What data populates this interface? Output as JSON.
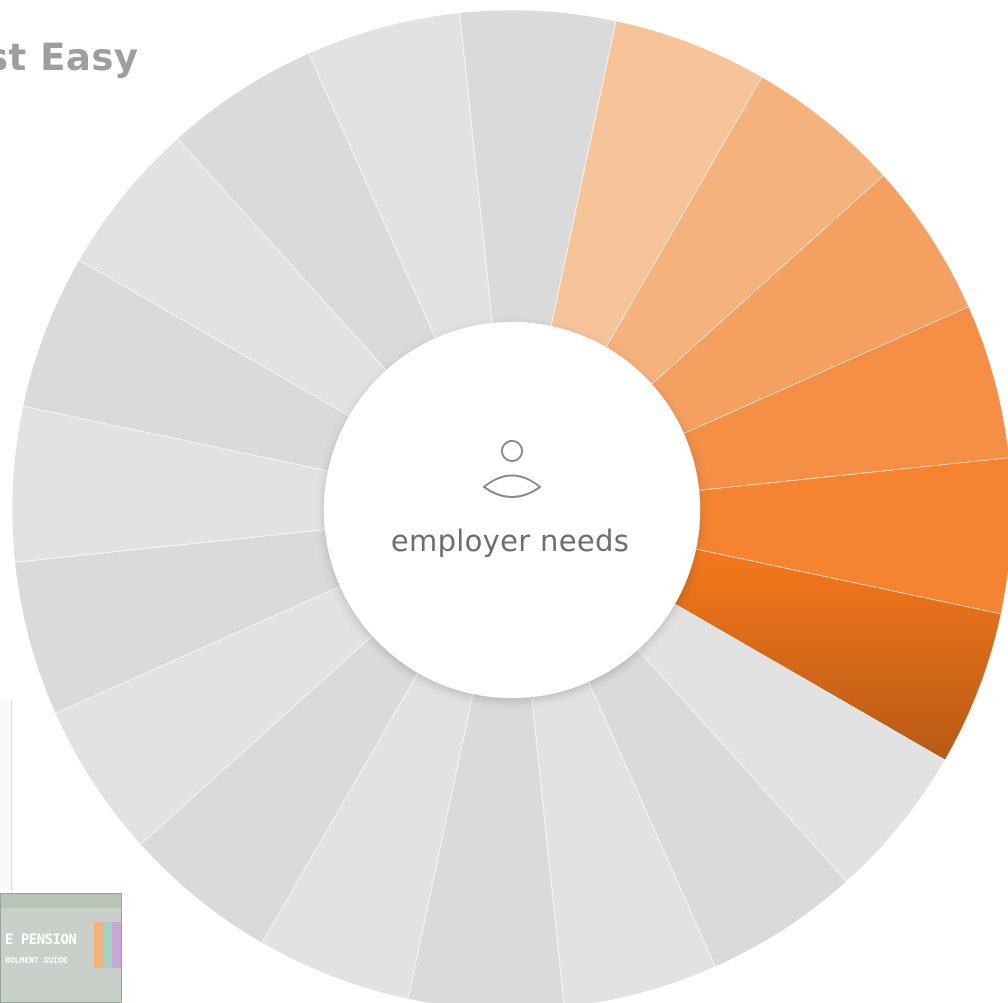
{
  "header": {
    "title_partial": "st Easy"
  },
  "wheel": {
    "center_label": "employer needs",
    "center_icon": "person-icon",
    "segments_total": 20,
    "highlighted_segments": 6,
    "colors": {
      "orange": [
        "#f7c49a",
        "#f6b27d",
        "#f5a060",
        "#f58f45",
        "#f5832f",
        "#f5781c"
      ],
      "gray": "#e2e2e2",
      "gray_alt": "#dadada",
      "center": "#ffffff"
    }
  },
  "thumbnail": {
    "line1": "E PENSION",
    "line2": "ROLMENT GUIDE"
  }
}
